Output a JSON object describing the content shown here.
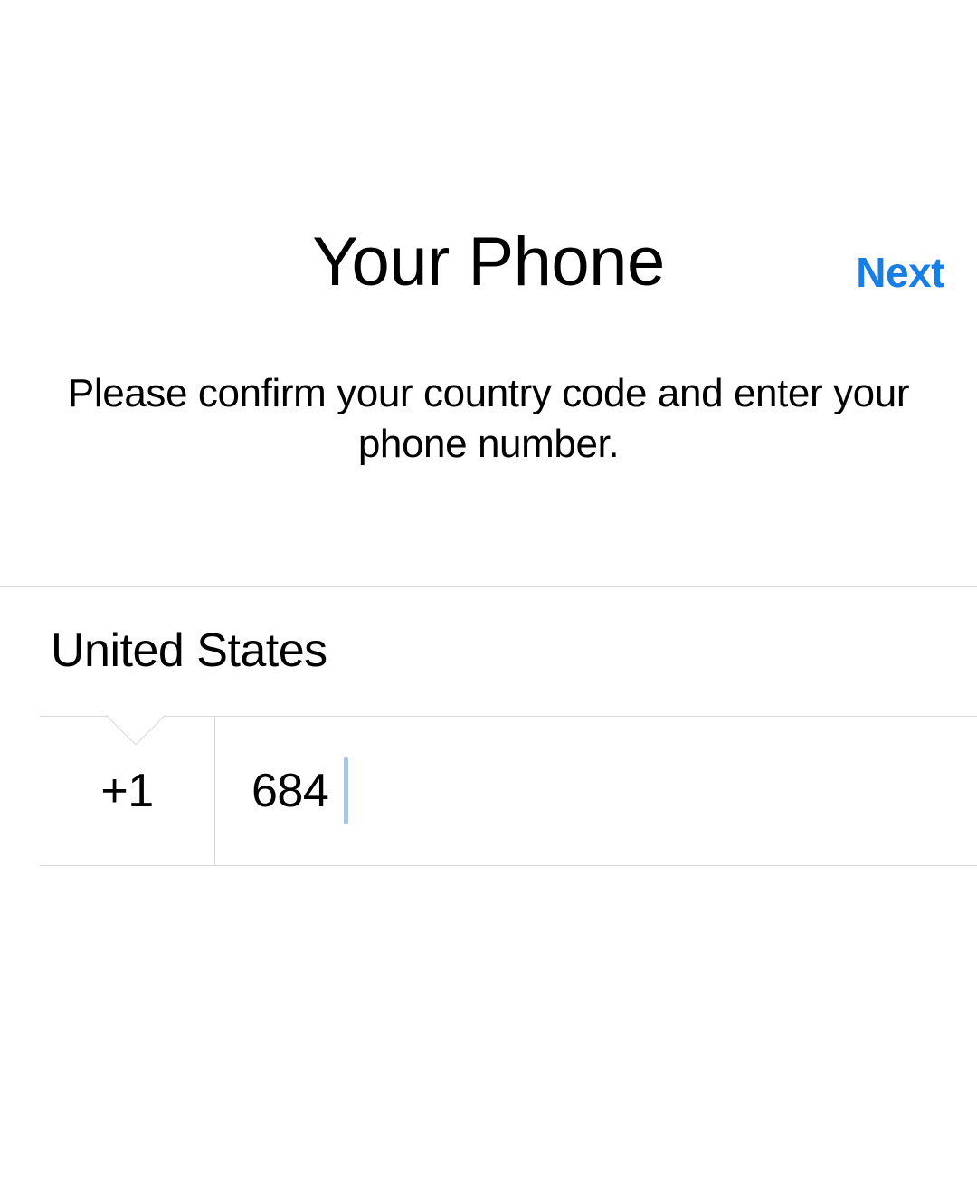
{
  "header": {
    "next_label": "Next"
  },
  "main": {
    "title": "Your Phone",
    "subtitle": "Please confirm your country code and enter your phone number."
  },
  "form": {
    "country_name": "United States",
    "country_code": "+1",
    "phone_value": "684"
  }
}
